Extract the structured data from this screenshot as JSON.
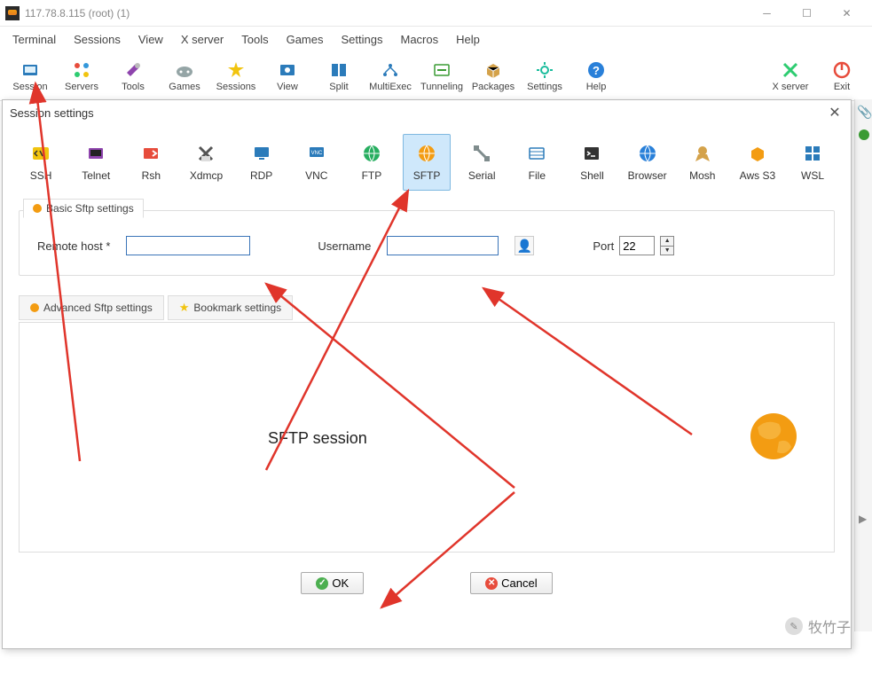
{
  "window": {
    "title": "117.78.8.115 (root) (1)"
  },
  "menubar": [
    "Terminal",
    "Sessions",
    "View",
    "X server",
    "Tools",
    "Games",
    "Settings",
    "Macros",
    "Help"
  ],
  "toolbar": [
    {
      "id": "session",
      "label": "Session"
    },
    {
      "id": "servers",
      "label": "Servers"
    },
    {
      "id": "tools",
      "label": "Tools"
    },
    {
      "id": "games",
      "label": "Games"
    },
    {
      "id": "sessions",
      "label": "Sessions"
    },
    {
      "id": "view",
      "label": "View"
    },
    {
      "id": "split",
      "label": "Split"
    },
    {
      "id": "multiexec",
      "label": "MultiExec"
    },
    {
      "id": "tunneling",
      "label": "Tunneling"
    },
    {
      "id": "packages",
      "label": "Packages"
    },
    {
      "id": "settings",
      "label": "Settings"
    },
    {
      "id": "help",
      "label": "Help"
    }
  ],
  "toolbar_right": [
    {
      "id": "xserver",
      "label": "X server"
    },
    {
      "id": "exit",
      "label": "Exit"
    }
  ],
  "dialog": {
    "title": "Session settings",
    "session_types": [
      {
        "id": "ssh",
        "label": "SSH"
      },
      {
        "id": "telnet",
        "label": "Telnet"
      },
      {
        "id": "rsh",
        "label": "Rsh"
      },
      {
        "id": "xdmcp",
        "label": "Xdmcp"
      },
      {
        "id": "rdp",
        "label": "RDP"
      },
      {
        "id": "vnc",
        "label": "VNC"
      },
      {
        "id": "ftp",
        "label": "FTP"
      },
      {
        "id": "sftp",
        "label": "SFTP",
        "selected": true
      },
      {
        "id": "serial",
        "label": "Serial"
      },
      {
        "id": "file",
        "label": "File"
      },
      {
        "id": "shell",
        "label": "Shell"
      },
      {
        "id": "browser",
        "label": "Browser"
      },
      {
        "id": "mosh",
        "label": "Mosh"
      },
      {
        "id": "awss3",
        "label": "Aws S3"
      },
      {
        "id": "wsl",
        "label": "WSL"
      }
    ],
    "basic_tab": "Basic Sftp settings",
    "remote_host_label": "Remote host *",
    "remote_host_value": "",
    "username_label": "Username",
    "username_value": "",
    "port_label": "Port",
    "port_value": "22",
    "advanced_tab": "Advanced Sftp settings",
    "bookmark_tab": "Bookmark settings",
    "session_area_label": "SFTP session",
    "ok_label": "OK",
    "cancel_label": "Cancel"
  },
  "watermark": "牧竹子",
  "icon_colors": {
    "session": "#2b7bba",
    "servers": "#e74c3c",
    "tools": "#8e44ad",
    "games": "#95a5a6",
    "sessions": "#f1c40f",
    "view": "#2b7bba",
    "split": "#2b7bba",
    "multiexec": "#2b7bba",
    "tunneling": "#3a9b33",
    "packages": "#d4a24a",
    "settings": "#1abc9c",
    "help": "#2980d9",
    "xserver": "#2ecc71",
    "exit": "#e74c3c",
    "ssh": "#f1c40f",
    "telnet": "#8e44ad",
    "rsh": "#e74c3c",
    "xdmcp": "#555",
    "rdp": "#2b7bba",
    "vnc": "#2b7bba",
    "ftp": "#27ae60",
    "sftp": "#f39c12",
    "serial": "#7f8c8d",
    "file": "#2b7bba",
    "shell": "#333",
    "browser": "#2980d9",
    "mosh": "#d4a24a",
    "awss3": "#f39c12",
    "wsl": "#2b7bba"
  }
}
